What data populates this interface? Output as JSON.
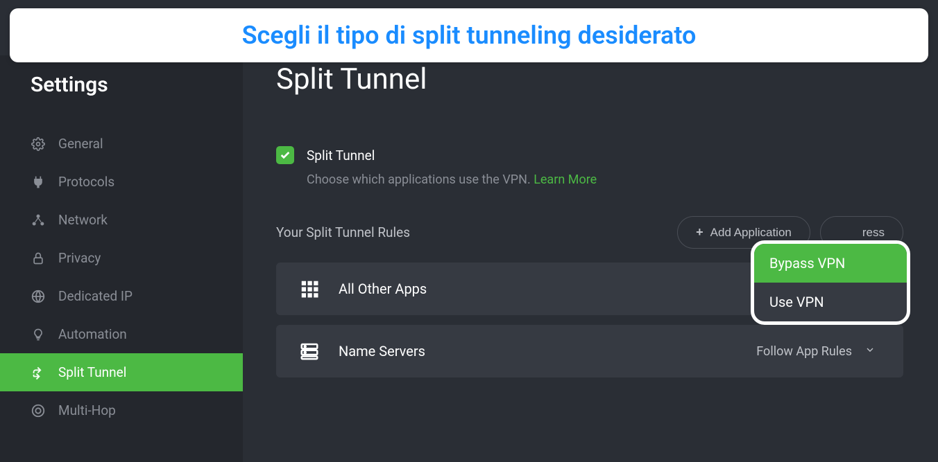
{
  "annotation": "Scegli il tipo di split tunneling desiderato",
  "sidebar": {
    "title": "Settings",
    "items": [
      {
        "label": "General",
        "icon": "gear"
      },
      {
        "label": "Protocols",
        "icon": "plug"
      },
      {
        "label": "Network",
        "icon": "network"
      },
      {
        "label": "Privacy",
        "icon": "lock"
      },
      {
        "label": "Dedicated IP",
        "icon": "globe-ip"
      },
      {
        "label": "Automation",
        "icon": "bulb"
      },
      {
        "label": "Split Tunnel",
        "icon": "split"
      },
      {
        "label": "Multi-Hop",
        "icon": "multihop"
      }
    ]
  },
  "main": {
    "title": "Split Tunnel",
    "toggle_label": "Split Tunnel",
    "toggle_description": "Choose which applications use the VPN.",
    "learn_more": "Learn More",
    "rules_title": "Your Split Tunnel Rules",
    "add_app_btn": "Add Application",
    "add_ip_btn_suffix": "ress",
    "rules": [
      {
        "label": "All Other Apps",
        "icon": "grid",
        "selector": ""
      },
      {
        "label": "Name Servers",
        "icon": "servers",
        "selector": "Follow App Rules"
      }
    ],
    "dropdown": {
      "items": [
        "Bypass VPN",
        "Use VPN"
      ],
      "selected": "Bypass VPN"
    }
  }
}
